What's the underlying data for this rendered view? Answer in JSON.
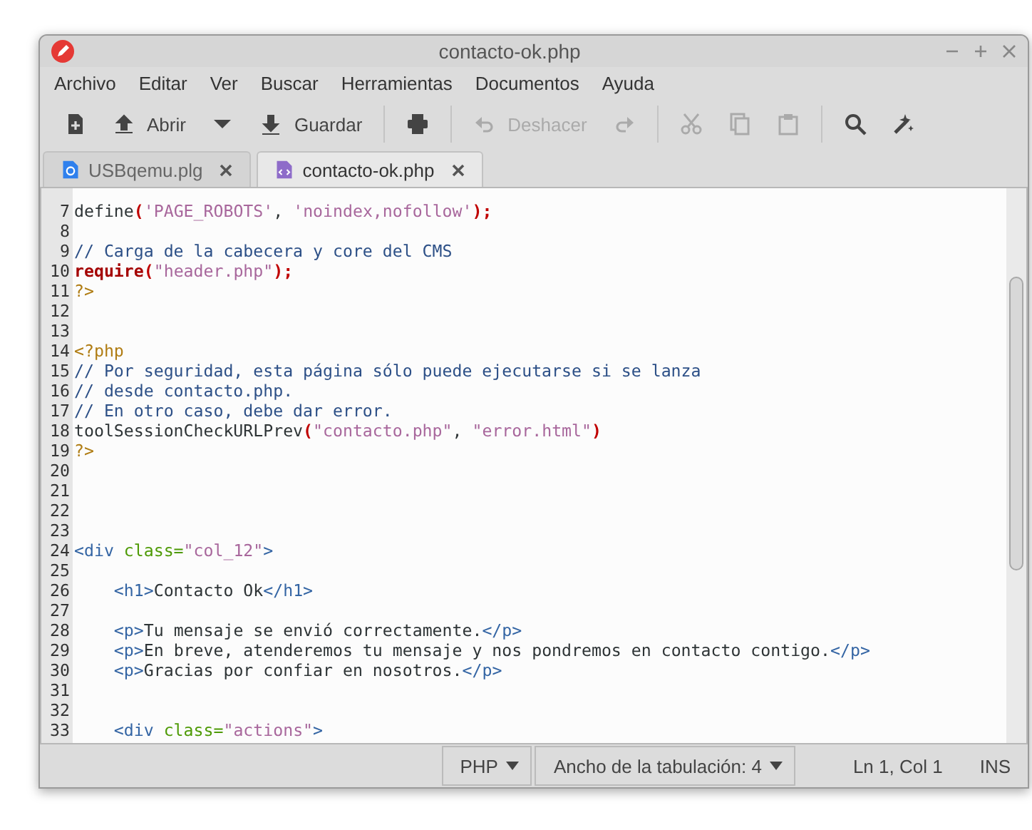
{
  "window": {
    "title": "contacto-ok.php"
  },
  "menu": [
    "Archivo",
    "Editar",
    "Ver",
    "Buscar",
    "Herramientas",
    "Documentos",
    "Ayuda"
  ],
  "toolbar": [
    {
      "kind": "icon",
      "disabled": false
    },
    {
      "kind": "labeled",
      "label": "Abrir",
      "disabled": false
    },
    {
      "kind": "dropdown",
      "disabled": false
    },
    {
      "kind": "labeled",
      "label": "Guardar",
      "disabled": false
    },
    {
      "kind": "separator"
    },
    {
      "kind": "icon",
      "disabled": false
    },
    {
      "kind": "separator"
    },
    {
      "kind": "labeled",
      "label": "Deshacer",
      "disabled": true
    },
    {
      "kind": "icon",
      "disabled": true
    },
    {
      "kind": "separator"
    },
    {
      "kind": "icon",
      "disabled": true
    },
    {
      "kind": "icon",
      "disabled": true
    },
    {
      "kind": "icon",
      "disabled": true
    },
    {
      "kind": "separator"
    },
    {
      "kind": "icon",
      "disabled": false
    },
    {
      "kind": "icon",
      "disabled": false
    }
  ],
  "tabs": [
    {
      "label": "USBqemu.plg",
      "selected": false
    },
    {
      "label": "contacto-ok.php",
      "selected": true
    }
  ],
  "editor": {
    "lines": [
      {
        "number": "7",
        "tokens": [
          {
            "kind": "plain",
            "text": "define"
          },
          {
            "kind": "paren",
            "text": "("
          },
          {
            "kind": "string",
            "text": "'PAGE_ROBOTS'"
          },
          {
            "kind": "plain",
            "text": ", "
          },
          {
            "kind": "string",
            "text": "'noindex,nofollow'"
          },
          {
            "kind": "paren",
            "text": ");"
          }
        ]
      },
      {
        "number": "8"
      },
      {
        "number": "9",
        "tokens": [
          {
            "kind": "comment",
            "text": "// Carga de la cabecera y core del CMS"
          }
        ]
      },
      {
        "number": "10",
        "tokens": [
          {
            "kind": "keyword",
            "text": "require"
          },
          {
            "kind": "paren",
            "text": "("
          },
          {
            "kind": "string",
            "text": "\"header.php\""
          },
          {
            "kind": "paren",
            "text": ");"
          }
        ]
      },
      {
        "number": "11",
        "tokens": [
          {
            "kind": "php",
            "text": "?>"
          }
        ]
      },
      {
        "number": "12"
      },
      {
        "number": "13"
      },
      {
        "number": "14",
        "tokens": [
          {
            "kind": "php",
            "text": "<?php"
          }
        ]
      },
      {
        "number": "15",
        "tokens": [
          {
            "kind": "comment",
            "text": "// Por seguridad, esta página sólo puede ejecutarse si se lanza"
          }
        ]
      },
      {
        "number": "16",
        "tokens": [
          {
            "kind": "comment",
            "text": "// desde contacto.php."
          }
        ]
      },
      {
        "number": "17",
        "tokens": [
          {
            "kind": "comment",
            "text": "// En otro caso, debe dar error."
          }
        ]
      },
      {
        "number": "18",
        "tokens": [
          {
            "kind": "plain",
            "text": "toolSessionCheckURLPrev"
          },
          {
            "kind": "paren",
            "text": "("
          },
          {
            "kind": "string",
            "text": "\"contacto.php\""
          },
          {
            "kind": "plain",
            "text": ", "
          },
          {
            "kind": "string",
            "text": "\"error.html\""
          },
          {
            "kind": "paren",
            "text": ")"
          }
        ]
      },
      {
        "number": "19",
        "tokens": [
          {
            "kind": "php",
            "text": "?>"
          }
        ]
      },
      {
        "number": "20"
      },
      {
        "number": "21"
      },
      {
        "number": "22"
      },
      {
        "number": "23"
      },
      {
        "number": "24",
        "tokens": [
          {
            "kind": "tag",
            "text": "<div "
          },
          {
            "kind": "attr",
            "text": "class="
          },
          {
            "kind": "string",
            "text": "\"col_12\""
          },
          {
            "kind": "tag",
            "text": ">"
          }
        ]
      },
      {
        "number": "25"
      },
      {
        "number": "26",
        "tokens": [
          {
            "kind": "tag",
            "text": "    <h1>"
          },
          {
            "kind": "plain",
            "text": "Contacto Ok"
          },
          {
            "kind": "tag",
            "text": "</h1>"
          }
        ]
      },
      {
        "number": "27"
      },
      {
        "number": "28",
        "tokens": [
          {
            "kind": "tag",
            "text": "    <p>"
          },
          {
            "kind": "plain",
            "text": "Tu mensaje se envió correctamente."
          },
          {
            "kind": "tag",
            "text": "</p>"
          }
        ]
      },
      {
        "number": "29",
        "tokens": [
          {
            "kind": "tag",
            "text": "    <p>"
          },
          {
            "kind": "plain",
            "text": "En breve, atenderemos tu mensaje y nos pondremos en contacto contigo."
          },
          {
            "kind": "tag",
            "text": "</p>"
          }
        ]
      },
      {
        "number": "30",
        "tokens": [
          {
            "kind": "tag",
            "text": "    <p>"
          },
          {
            "kind": "plain",
            "text": "Gracias por confiar en nosotros."
          },
          {
            "kind": "tag",
            "text": "</p>"
          }
        ]
      },
      {
        "number": "31"
      },
      {
        "number": "32"
      },
      {
        "number": "33",
        "tokens": [
          {
            "kind": "tag",
            "text": "    <div "
          },
          {
            "kind": "attr",
            "text": "class="
          },
          {
            "kind": "string",
            "text": "\"actions\""
          },
          {
            "kind": "tag",
            "text": ">"
          }
        ]
      }
    ]
  },
  "status_bar": {
    "language": "PHP",
    "tab_width": "Ancho de la tabulación:  4",
    "position": "Ln 1, Col 1",
    "mode": "INS"
  }
}
